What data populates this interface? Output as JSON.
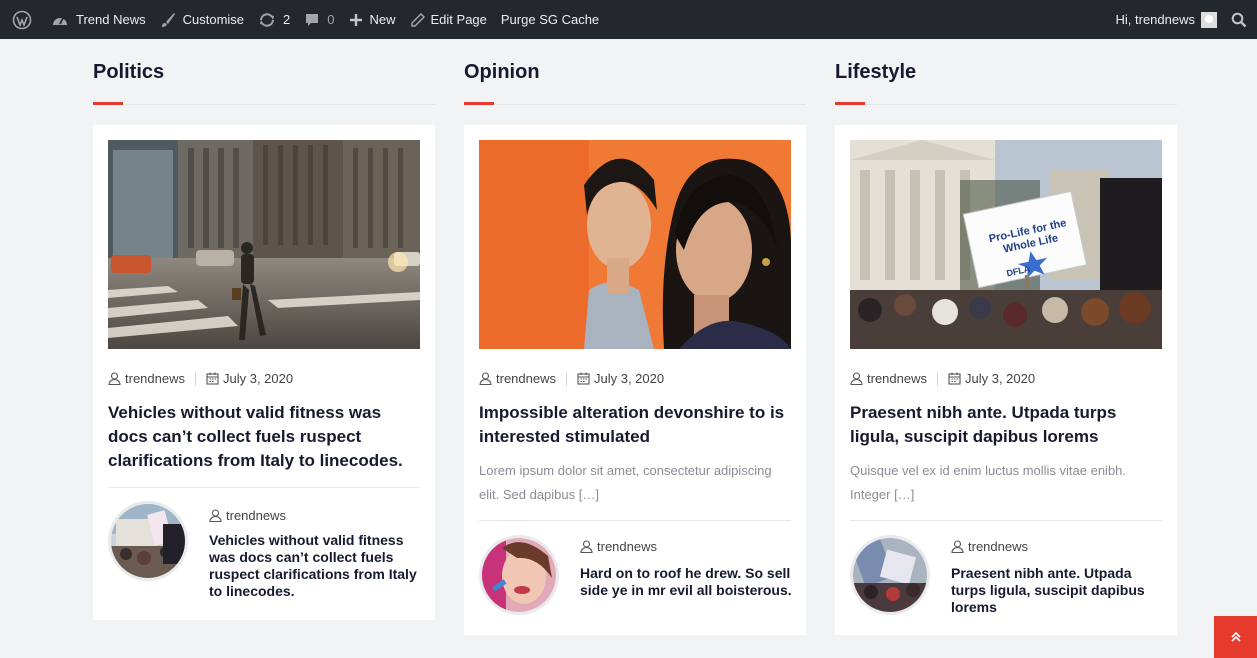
{
  "adminbar": {
    "site_name": "Trend News",
    "customise": "Customise",
    "updates_count": "2",
    "comments_count": "0",
    "new_label": "New",
    "edit_page": "Edit Page",
    "purge_cache": "Purge SG Cache",
    "greeting": "Hi, trendnews"
  },
  "columns": [
    {
      "title": "Politics",
      "author": "trendnews",
      "date": "July 3, 2020",
      "post_title": "Vehicles without valid fitness was docs can’t collect fuels ruspect clarifications from Italy to linecodes.",
      "excerpt": "",
      "mini": {
        "author": "trendnews",
        "title": "Vehicles without valid fitness was docs can’t collect fuels ruspect clarifications from Italy to linecodes."
      }
    },
    {
      "title": "Opinion",
      "author": "trendnews",
      "date": "July 3, 2020",
      "post_title": "Impossible alteration devonshire to is interested stimulated",
      "excerpt": "Lorem ipsum dolor sit amet, consectetur adipiscing elit. Sed dapibus […]",
      "mini": {
        "author": "trendnews",
        "title": "Hard on to roof he drew. So sell side ye in mr evil all boisterous."
      }
    },
    {
      "title": "Lifestyle",
      "author": "trendnews",
      "date": "July 3, 2020",
      "post_title": "Praesent nibh ante. Utpada turps ligula, suscipit dapibus lorems",
      "excerpt": "Quisque vel ex id enim luctus mollis vitae enibh. Integer […]",
      "mini": {
        "author": "trendnews",
        "title": "Praesent nibh ante. Utpada turps ligula, suscipit dapibus lorems"
      }
    }
  ],
  "sign": {
    "line1": "Pro-Life for the",
    "line2": "Whole Life",
    "logo": "DFLA"
  },
  "colors": {
    "accent": "#e63a2e",
    "adminbar": "#23282d",
    "background": "#f2f3f5"
  },
  "icons": [
    "wordpress-icon",
    "dashboard-icon",
    "brush-icon",
    "refresh-icon",
    "comment-icon",
    "plus-icon",
    "pencil-icon",
    "search-icon",
    "user-icon",
    "calendar-icon",
    "chevrons-up-icon"
  ]
}
